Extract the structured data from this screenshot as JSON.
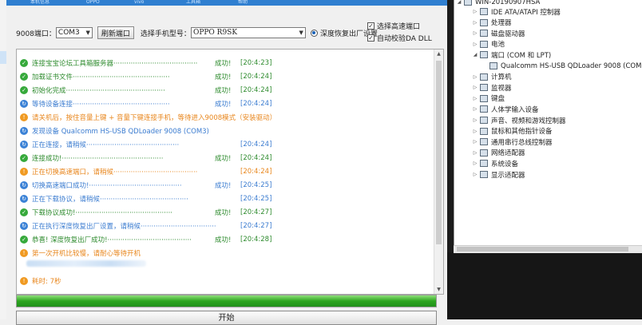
{
  "top_tabs": [
    "本机信息",
    "OPPO",
    "vivo",
    "工具箱",
    "帮助"
  ],
  "controls": {
    "port_label": "9008端口：",
    "port_value": "COM3",
    "refresh_label": "刷新端口",
    "model_label": "选择手机型号：",
    "model_value": "OPPO R9SK",
    "factory_reset_label": "深度恢复出厂设置",
    "high_speed_label": "选择高速端口",
    "auto_verify_label": "自动校验DA DLL"
  },
  "log": [
    {
      "type": "ok",
      "text": "连接宝宝论坛工具箱服务器",
      "dots": "·······································",
      "status": "成功!",
      "time": "[20:4:23]"
    },
    {
      "type": "ok",
      "text": "加载证书文件",
      "dots": "·············································",
      "status": "成功!",
      "time": "[20:4:24]"
    },
    {
      "type": "ok",
      "text": "初始化完成",
      "dots": "··············································",
      "status": "成功!",
      "time": "[20:4:24]"
    },
    {
      "type": "info",
      "text": "等待设备连接",
      "dots": "·············································",
      "status": "成功!",
      "time": "[20:4:24]"
    },
    {
      "type": "warn",
      "text": "请关机后，按住音量上键 + 音量下键连接手机，等待进入9008模式（安装驱动）",
      "dots": "",
      "status": "",
      "time": ""
    },
    {
      "type": "info",
      "text": "发现设备 Qualcomm HS-USB QDLoader 9008 (COM3)",
      "dots": "",
      "status": "",
      "time": ""
    },
    {
      "type": "info",
      "text": "正在连接，请稍候",
      "dots": "···········································",
      "status": "",
      "time": "[20:4:24]"
    },
    {
      "type": "ok",
      "text": "连接成功!",
      "dots": "···············································",
      "status": "成功!",
      "time": "[20:4:24]"
    },
    {
      "type": "warn",
      "text": "正在切换高速端口，请稍候",
      "dots": "·······································",
      "status": "",
      "time": "[20:4:24]"
    },
    {
      "type": "info",
      "text": "切换高速端口成功!",
      "dots": "···········································",
      "status": "成功!",
      "time": "[20:4:25]"
    },
    {
      "type": "info",
      "text": "正在下载协议，请稍候",
      "dots": "·········································",
      "status": "",
      "time": "[20:4:25]"
    },
    {
      "type": "ok",
      "text": "下载协议成功!",
      "dots": "·············································",
      "status": "成功!",
      "time": "[20:4:27]"
    },
    {
      "type": "info",
      "text": "正在执行深度恢复出厂设置，请稍候",
      "dots": "···································",
      "status": "",
      "time": "[20:4:27]"
    },
    {
      "type": "ok",
      "text": "恭喜! 深度恢复出厂成功!",
      "dots": "·······································",
      "status": "成功!",
      "time": "[20:4:28]"
    },
    {
      "type": "warn",
      "text": "第一次开机比较慢，请耐心等待开机",
      "dots": "",
      "status": "",
      "time": ""
    },
    {
      "type": "warn",
      "text": "耗时: 7秒",
      "dots": "",
      "status": "",
      "time": ""
    }
  ],
  "progress": {
    "percent": 100
  },
  "start_button": "开始",
  "device_manager": {
    "computer": "WIN-20190907HSA",
    "items": [
      {
        "label": "IDE ATA/ATAPI 控制器",
        "expand": "▷",
        "indent": 1
      },
      {
        "label": "处理器",
        "expand": "▷",
        "indent": 1
      },
      {
        "label": "磁盘驱动器",
        "expand": "▷",
        "indent": 1
      },
      {
        "label": "电池",
        "expand": "▷",
        "indent": 1
      },
      {
        "label": "端口 (COM 和 LPT)",
        "expand": "◢",
        "indent": 1
      },
      {
        "label": "Qualcomm HS-USB QDLoader 9008 (COM3)",
        "expand": "",
        "indent": 2
      },
      {
        "label": "计算机",
        "expand": "▷",
        "indent": 1
      },
      {
        "label": "监视器",
        "expand": "▷",
        "indent": 1
      },
      {
        "label": "键盘",
        "expand": "▷",
        "indent": 1
      },
      {
        "label": "人体学输入设备",
        "expand": "▷",
        "indent": 1
      },
      {
        "label": "声音、视频和游戏控制器",
        "expand": "▷",
        "indent": 1
      },
      {
        "label": "鼠标和其他指针设备",
        "expand": "▷",
        "indent": 1
      },
      {
        "label": "通用串行总线控制器",
        "expand": "▷",
        "indent": 1
      },
      {
        "label": "网络适配器",
        "expand": "▷",
        "indent": 1
      },
      {
        "label": "系统设备",
        "expand": "▷",
        "indent": 1
      },
      {
        "label": "显示适配器",
        "expand": "▷",
        "indent": 1
      }
    ]
  }
}
